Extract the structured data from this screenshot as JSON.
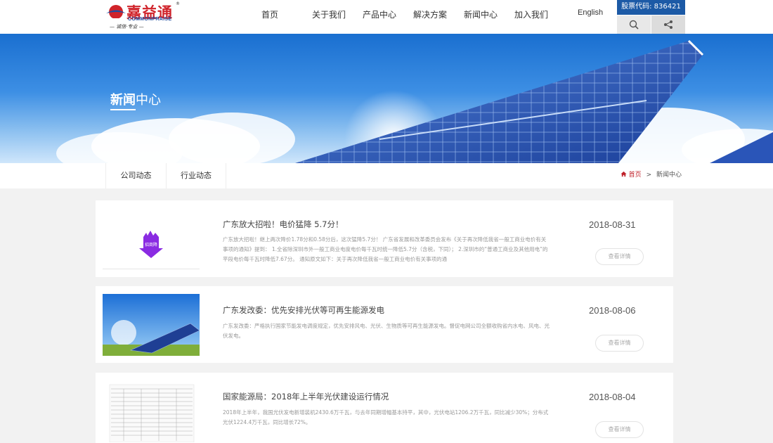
{
  "header": {
    "logo_text": "嘉益通",
    "logo_en": "COMMONPRAISE",
    "logo_reg": "®",
    "logo_slogan": "— 诚信·专业 —",
    "nav": [
      "首页",
      "关于我们",
      "产品中心",
      "解决方案",
      "新闻中心",
      "加入我们"
    ],
    "english": "English",
    "stock": "股票代码: 836421",
    "icons": [
      "search-icon",
      "share-icon"
    ]
  },
  "banner": {
    "title_bold": "新闻",
    "title_rest": "中心"
  },
  "subnav": {
    "tabs": [
      "公司动态",
      "行业动态"
    ],
    "crumb_home": "首页",
    "crumb_sep": ">",
    "crumb_current": "新闻中心"
  },
  "news": [
    {
      "title": "广东放大招啦！电价猛降 5.7分！",
      "desc": "广东放大招啦！继上两次降价1.78分和0.58分后，这次猛降5.7分！ 广东省发展和改革委员会发布《关于再次降低我省一般工商业电价有关事项的通知》提到： 1.全省除深圳市外一般工商业电度电价每千瓦时统一降低5.7分（含税，下同）； 2.深圳市的“普通工商业及其他用电”的平段电价每千瓦时降低7.67分。 通知原文如下：关于再次降低我省一般工商业电价有关事项的通",
      "date": "2018-08-31",
      "more": "查看详情",
      "thumb_label": "招商降"
    },
    {
      "title": "广东发改委：优先安排光伏等可再生能源发电",
      "desc": "广东发改委：严格执行国家节能发电调度规定，优先安排风电、光伏、生物质等可再生能源发电。督促电网公司全额收购省内水电、风电、光伏发电。",
      "date": "2018-08-06",
      "more": "查看详情"
    },
    {
      "title": "国家能源局：2018年上半年光伏建设运行情况",
      "desc": "2018年上半年，我国光伏发电新增装机2430.6万千瓦，与去年同期增幅基本持平，其中，光伏电站1206.2万千瓦，同比减少30%；分布式光伏1224.4万千瓦，同比增长72%。",
      "date": "2018-08-04",
      "more": "查看详情"
    }
  ],
  "colors": {
    "brand_blue": "#1c5aa6",
    "brand_red": "#d0232a",
    "purple": "#8a2be2"
  }
}
